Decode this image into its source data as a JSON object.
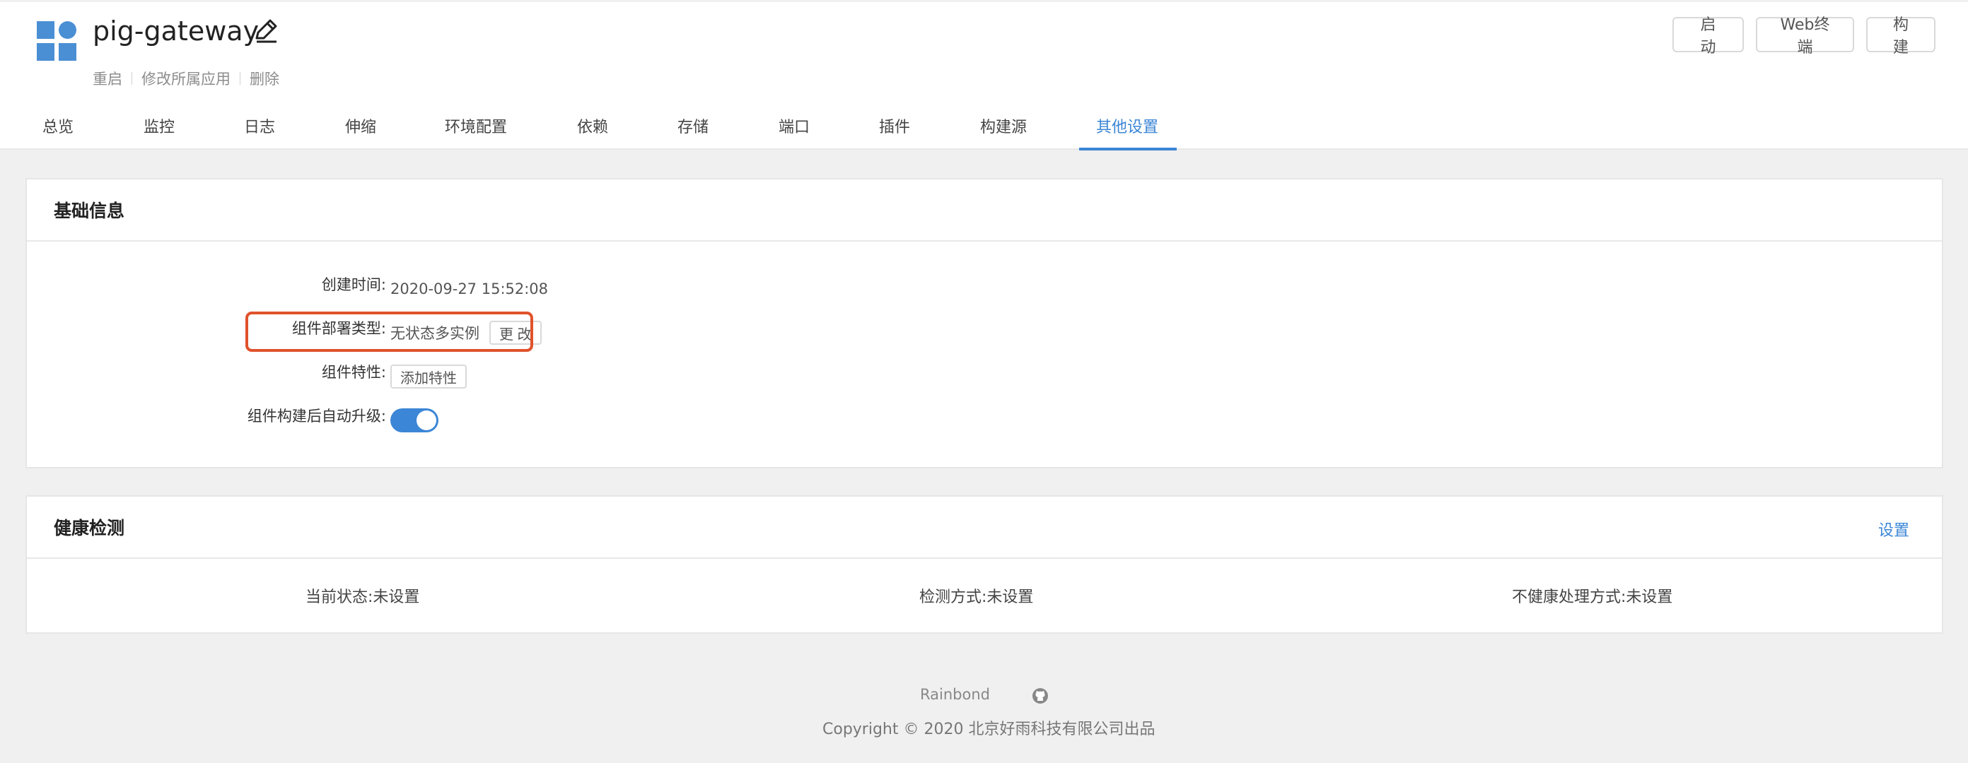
{
  "app": {
    "title": "pig-gateway"
  },
  "sub_actions": [
    "重启",
    "修改所属应用",
    "删除"
  ],
  "top_buttons": {
    "start": "启 动",
    "web_terminal": "Web终端",
    "build": "构 建"
  },
  "tabs": [
    {
      "label": "总览"
    },
    {
      "label": "监控"
    },
    {
      "label": "日志"
    },
    {
      "label": "伸缩"
    },
    {
      "label": "环境配置"
    },
    {
      "label": "依赖"
    },
    {
      "label": "存储"
    },
    {
      "label": "端口"
    },
    {
      "label": "插件"
    },
    {
      "label": "构建源"
    },
    {
      "label": "其他设置",
      "active": true
    }
  ],
  "basic_info": {
    "title": "基础信息",
    "created_label": "创建时间:",
    "created_value": "2020-09-27 15:52:08",
    "deploy_type_label": "组件部署类型:",
    "deploy_type_value": "无状态多实例",
    "change_button": "更 改",
    "feature_label": "组件特性:",
    "add_feature_button": "添加特性",
    "auto_upgrade_label": "组件构建后自动升级:",
    "auto_upgrade_enabled": true
  },
  "health": {
    "title": "健康检测",
    "settings_link": "设置",
    "current_status": "当前状态:未设置",
    "check_method": "检测方式:未设置",
    "unhealthy_handling": "不健康处理方式:未设置"
  },
  "footer": {
    "brand": "Rainbond",
    "copyright": "Copyright © 2020 北京好雨科技有限公司出品"
  },
  "colors": {
    "accent": "#3b86d6",
    "highlight": "#e0522c"
  }
}
